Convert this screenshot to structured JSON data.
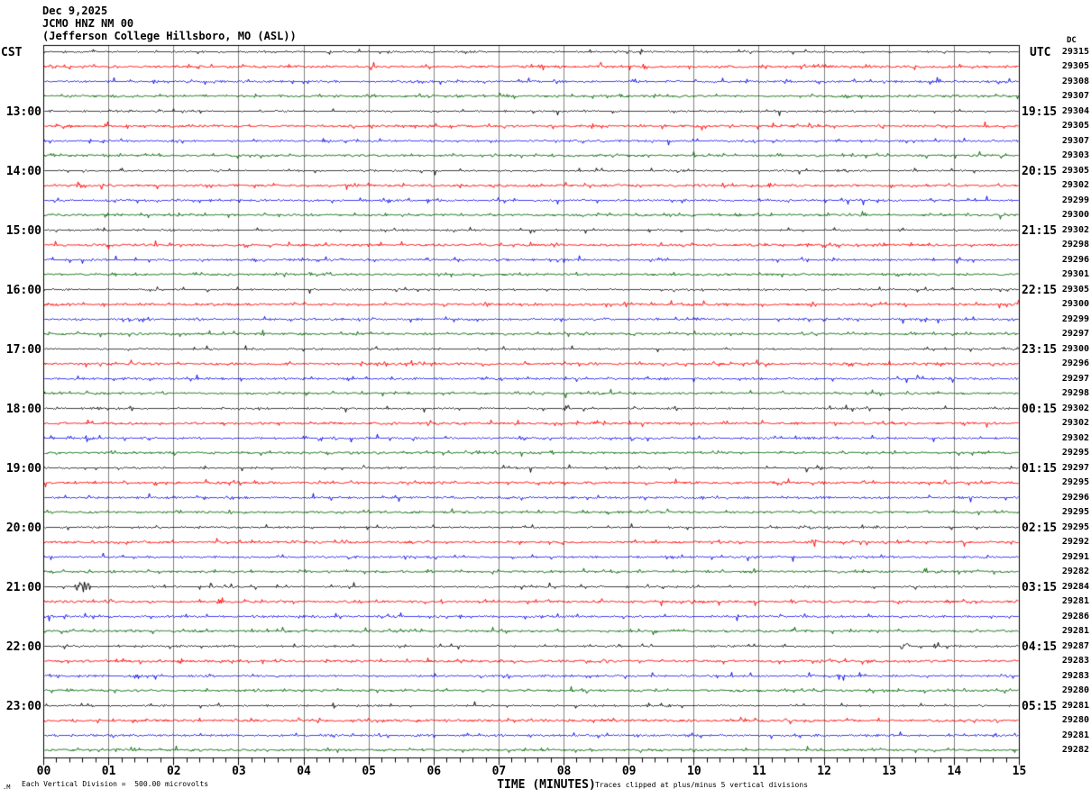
{
  "title": {
    "date": "Dec 9,2025",
    "station": "JCMO HNZ NM 00",
    "location": "(Jefferson College Hillsboro, MO (ASL))"
  },
  "axes": {
    "left_header": "CST",
    "right_header": "UTC",
    "dc_header": "DC",
    "x_title": "TIME (MINUTES)",
    "x_tick_labels": [
      "00",
      "01",
      "02",
      "03",
      "04",
      "05",
      "06",
      "07",
      "08",
      "09",
      "10",
      "11",
      "12",
      "13",
      "14",
      "15"
    ],
    "footer_mark": ".M",
    "footer_left": "Each Vertical Division =  500.00 microvolts",
    "footer_right": "Traces clipped at plus/minus 5 vertical divisions"
  },
  "colors": {
    "black": "#000000",
    "red": "#ff0000",
    "blue": "#0000ee",
    "green": "#006600",
    "grid": "#808080",
    "border": "#000000"
  },
  "chart_data": {
    "type": "line",
    "description": "Helicorder seismogram: 48 traces of 15 minutes each, 12 hours total, colors cycling black/red/blue/green; traces are near-flat noise around each baseline",
    "xlabel": "TIME (MINUTES)",
    "x_range_minutes": [
      0,
      15
    ],
    "minutes_per_row": 15,
    "grid": "vertical lines at each minute",
    "rows": [
      {
        "color": "black",
        "cst": "",
        "utc": "",
        "dc": "29315"
      },
      {
        "color": "red",
        "cst": "",
        "utc": "",
        "dc": "29305"
      },
      {
        "color": "blue",
        "cst": "",
        "utc": "",
        "dc": "29308"
      },
      {
        "color": "green",
        "cst": "",
        "utc": "",
        "dc": "29307"
      },
      {
        "color": "black",
        "cst": "13:00",
        "utc": "19:15",
        "dc": "29304"
      },
      {
        "color": "red",
        "cst": "",
        "utc": "",
        "dc": "29305"
      },
      {
        "color": "blue",
        "cst": "",
        "utc": "",
        "dc": "29307"
      },
      {
        "color": "green",
        "cst": "",
        "utc": "",
        "dc": "29303"
      },
      {
        "color": "black",
        "cst": "14:00",
        "utc": "20:15",
        "dc": "29305"
      },
      {
        "color": "red",
        "cst": "",
        "utc": "",
        "dc": "29302"
      },
      {
        "color": "blue",
        "cst": "",
        "utc": "",
        "dc": "29299"
      },
      {
        "color": "green",
        "cst": "",
        "utc": "",
        "dc": "29300"
      },
      {
        "color": "black",
        "cst": "15:00",
        "utc": "21:15",
        "dc": "29302"
      },
      {
        "color": "red",
        "cst": "",
        "utc": "",
        "dc": "29298"
      },
      {
        "color": "blue",
        "cst": "",
        "utc": "",
        "dc": "29296"
      },
      {
        "color": "green",
        "cst": "",
        "utc": "",
        "dc": "29301"
      },
      {
        "color": "black",
        "cst": "16:00",
        "utc": "22:15",
        "dc": "29305"
      },
      {
        "color": "red",
        "cst": "",
        "utc": "",
        "dc": "29300"
      },
      {
        "color": "blue",
        "cst": "",
        "utc": "",
        "dc": "29299"
      },
      {
        "color": "green",
        "cst": "",
        "utc": "",
        "dc": "29297"
      },
      {
        "color": "black",
        "cst": "17:00",
        "utc": "23:15",
        "dc": "29300"
      },
      {
        "color": "red",
        "cst": "",
        "utc": "",
        "dc": "29296"
      },
      {
        "color": "blue",
        "cst": "",
        "utc": "",
        "dc": "29297"
      },
      {
        "color": "green",
        "cst": "",
        "utc": "",
        "dc": "29298"
      },
      {
        "color": "black",
        "cst": "18:00",
        "utc": "00:15",
        "dc": "29302"
      },
      {
        "color": "red",
        "cst": "",
        "utc": "",
        "dc": "29302"
      },
      {
        "color": "blue",
        "cst": "",
        "utc": "",
        "dc": "29302"
      },
      {
        "color": "green",
        "cst": "",
        "utc": "",
        "dc": "29295"
      },
      {
        "color": "black",
        "cst": "19:00",
        "utc": "01:15",
        "dc": "29297"
      },
      {
        "color": "red",
        "cst": "",
        "utc": "",
        "dc": "29295"
      },
      {
        "color": "blue",
        "cst": "",
        "utc": "",
        "dc": "29296"
      },
      {
        "color": "green",
        "cst": "",
        "utc": "",
        "dc": "29295"
      },
      {
        "color": "black",
        "cst": "20:00",
        "utc": "02:15",
        "dc": "29295"
      },
      {
        "color": "red",
        "cst": "",
        "utc": "",
        "dc": "29292"
      },
      {
        "color": "blue",
        "cst": "",
        "utc": "",
        "dc": "29291"
      },
      {
        "color": "green",
        "cst": "",
        "utc": "",
        "dc": "29282"
      },
      {
        "color": "black",
        "cst": "21:00",
        "utc": "03:15",
        "dc": "29284"
      },
      {
        "color": "red",
        "cst": "",
        "utc": "",
        "dc": "29281"
      },
      {
        "color": "blue",
        "cst": "",
        "utc": "",
        "dc": "29286"
      },
      {
        "color": "green",
        "cst": "",
        "utc": "",
        "dc": "29281"
      },
      {
        "color": "black",
        "cst": "22:00",
        "utc": "04:15",
        "dc": "29287"
      },
      {
        "color": "red",
        "cst": "",
        "utc": "",
        "dc": "29283"
      },
      {
        "color": "blue",
        "cst": "",
        "utc": "",
        "dc": "29283"
      },
      {
        "color": "green",
        "cst": "",
        "utc": "",
        "dc": "29280"
      },
      {
        "color": "black",
        "cst": "23:00",
        "utc": "05:15",
        "dc": "29281"
      },
      {
        "color": "red",
        "cst": "",
        "utc": "",
        "dc": "29280"
      },
      {
        "color": "blue",
        "cst": "",
        "utc": "",
        "dc": "29281"
      },
      {
        "color": "green",
        "cst": "",
        "utc": "",
        "dc": "29282"
      }
    ],
    "events": [
      {
        "row": 9,
        "min": 0.55,
        "w": 6,
        "amp": 3
      },
      {
        "row": 24,
        "min": 0.85,
        "w": 3,
        "amp": 4
      },
      {
        "row": 27,
        "min": 2.0,
        "w": 2,
        "amp": 4
      },
      {
        "row": 28,
        "min": 2.45,
        "w": 4,
        "amp": 3
      },
      {
        "row": 32,
        "min": 11.8,
        "w": 3,
        "amp": 3
      },
      {
        "row": 33,
        "min": 11.85,
        "w": 3,
        "amp": 6
      },
      {
        "row": 36,
        "min": 0.6,
        "w": 9,
        "amp": 7
      },
      {
        "row": 37,
        "min": 2.72,
        "w": 4,
        "amp": 5
      },
      {
        "row": 40,
        "min": 13.25,
        "w": 6,
        "amp": 4
      },
      {
        "row": 44,
        "min": 9.6,
        "w": 3,
        "amp": 3
      }
    ]
  }
}
